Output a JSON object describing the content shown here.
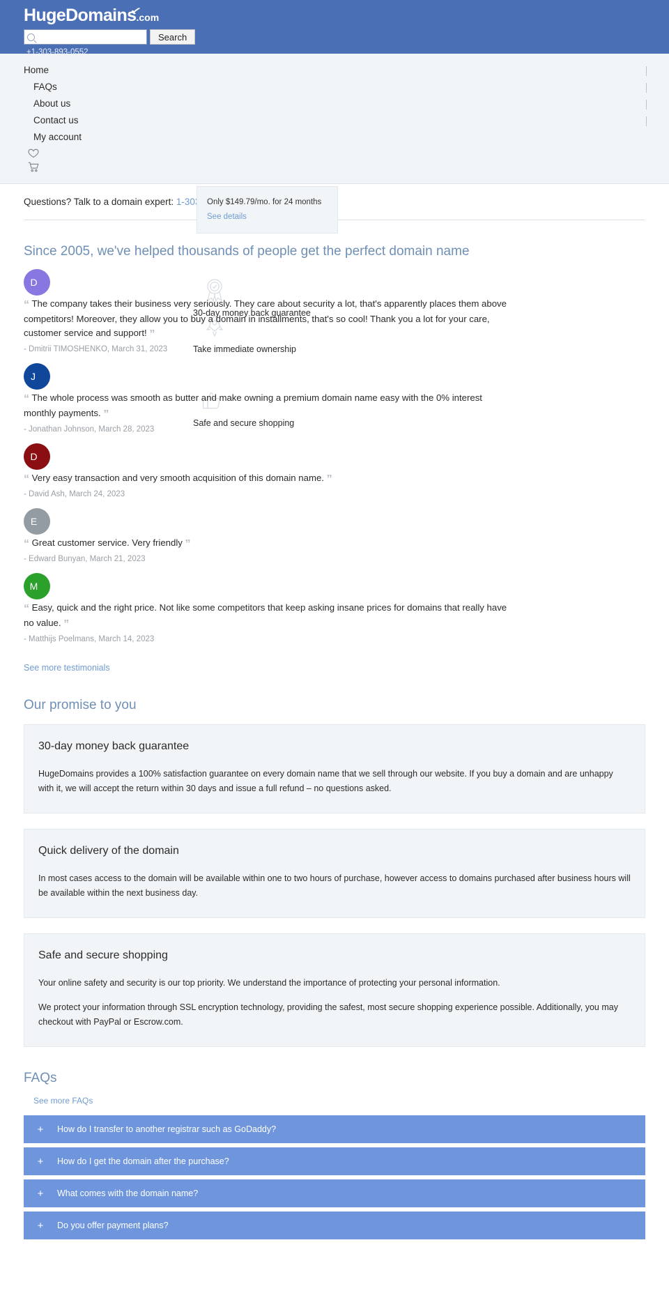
{
  "header": {
    "logo_main": "HugeDomains",
    "logo_tld": ".com",
    "search_value": "",
    "search_placeholder": "",
    "search_button": "Search",
    "phone": "+1-303-893-0552"
  },
  "nav": {
    "items": [
      {
        "label": "Home"
      },
      {
        "label": "FAQs"
      },
      {
        "label": "About us"
      },
      {
        "label": "Contact us"
      },
      {
        "label": "My account"
      }
    ],
    "heart_icon": "♡",
    "cart_icon": "🛒"
  },
  "expert": {
    "text": "Questions? Talk to a domain expert:",
    "phone": "1-303-893-0552"
  },
  "tooltip": {
    "price_text": "Only $149.79/mo. for 24 months",
    "link": "See details"
  },
  "testimonials": {
    "heading": "Since 2005, we've helped thousands of people get the perfect domain name",
    "open_quote": "“",
    "close_quote": "”",
    "see_more": "See more testimonials",
    "items": [
      {
        "initial": "D",
        "color": "#8877e0",
        "quote": "The company takes their business very seriously. They care about security a lot, that's apparently places them above competitors! Moreover, they allow you to buy a domain in installments, that's so cool! Thank you a lot for your care, customer service and support!",
        "attrib": "- Dmitrii TIMOSHENKO, March 31, 2023"
      },
      {
        "initial": "J",
        "color": "#10479b",
        "quote": "The whole process was smooth as butter and make owning a premium domain name easy with the 0% interest monthly payments.",
        "attrib": "- Jonathan Johnson, March 28, 2023"
      },
      {
        "initial": "D",
        "color": "#8b0f12",
        "quote": "Very easy transaction and very smooth acquisition of this domain name.",
        "attrib": "- David Ash, March 24, 2023"
      },
      {
        "initial": "E",
        "color": "#939ba3",
        "quote": "Great customer service. Very friendly",
        "attrib": "- Edward Bunyan, March 21, 2023"
      },
      {
        "initial": "M",
        "color": "#2ba12b",
        "quote": "Easy, quick and the right price. Not like some competitors that keep asking insane prices for domains that really have no value.",
        "attrib": "- Matthijs Poelmans, March 14, 2023"
      }
    ]
  },
  "badges": [
    {
      "icon": "❁",
      "label": "30-day money back guarantee"
    },
    {
      "icon": "🚀",
      "label": "Take immediate ownership"
    },
    {
      "icon": "👍",
      "label": "Safe and secure shopping"
    }
  ],
  "promise": {
    "heading": "Our promise to you",
    "cards": [
      {
        "title": "30-day money back guarantee",
        "paragraphs": [
          "HugeDomains provides a 100% satisfaction guarantee on every domain name that we sell through our website. If you buy a domain and are unhappy with it, we will accept the return within 30 days and issue a full refund – no questions asked."
        ]
      },
      {
        "title": "Quick delivery of the domain",
        "paragraphs": [
          "In most cases access to the domain will be available within one to two hours of purchase, however access to domains purchased after business hours will be available within the next business day."
        ]
      },
      {
        "title": "Safe and secure shopping",
        "paragraphs": [
          "Your online safety and security is our top priority. We understand the importance of protecting your personal information.",
          "We protect your information through SSL encryption technology, providing the safest, most secure shopping experience possible. Additionally, you may checkout with PayPal or Escrow.com."
        ]
      }
    ]
  },
  "faqs": {
    "heading": "FAQs",
    "see_more": "See more FAQs",
    "plus_icon": "+",
    "items": [
      {
        "question": "How do I transfer to another registrar such as GoDaddy?"
      },
      {
        "question": "How do I get the domain after the purchase?"
      },
      {
        "question": "What comes with the domain name?"
      },
      {
        "question": "Do you offer payment plans?"
      }
    ]
  },
  "colors": {
    "header_blue": "#4a6fb5",
    "nav_bg": "#f1f5f8",
    "link_blue": "#6f9bd1",
    "heading_blue": "#6f8fb5",
    "faq_blue": "#6f96dd"
  }
}
